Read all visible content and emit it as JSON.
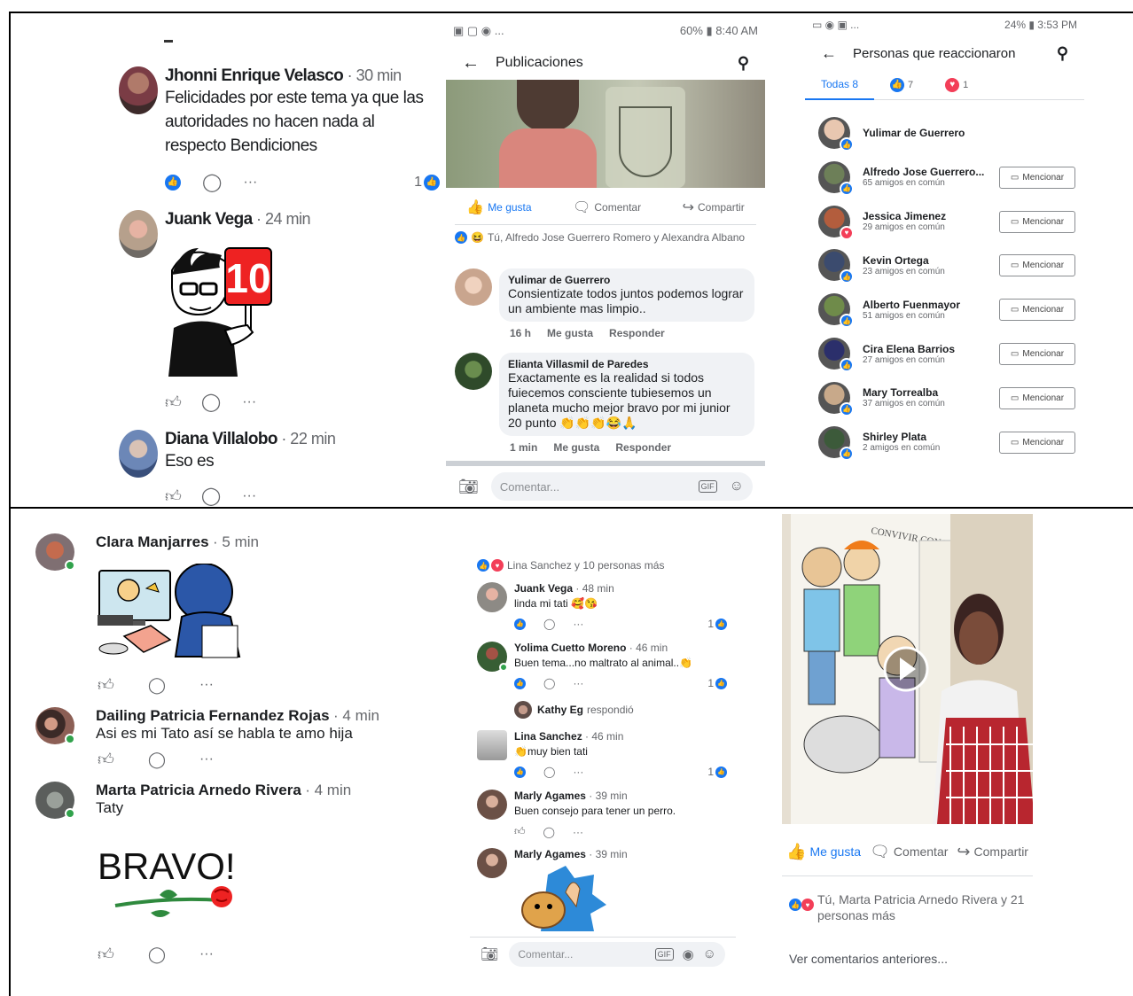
{
  "p1": {
    "comments": [
      {
        "name": "Jhonni Enrique Velasco",
        "time": "· 30 min",
        "text": "Felicidades por este tema ya que las autoridades no hacen nada al respecto Bendiciones",
        "reactions": "1"
      },
      {
        "name": "Juank Vega",
        "time": "· 24 min",
        "sticker_text": "10"
      },
      {
        "name": "Diana Villalobo",
        "time": "· 22 min",
        "text": "Eso es"
      }
    ]
  },
  "p2": {
    "status_left": "▣ ▢ ◉ ...",
    "status_right": "60% ▮ 8:40 AM",
    "title": "Publicaciones",
    "like_label": "Me gusta",
    "comment_label": "Comentar",
    "share_label": "Compartir",
    "reactors": "Tú, Alfredo Jose Guerrero Romero y Alexandra Albano",
    "comments": [
      {
        "name": "Yulimar de Guerrero",
        "text": "Consientizate todos juntos podemos lograr un ambiente mas limpio..",
        "time": "16 h",
        "like": "Me gusta",
        "reply": "Responder"
      },
      {
        "name": "Elianta Villasmil de Paredes",
        "text": "Exactamente es la realidad si todos fuiecemos consciente tubiesemos un planeta mucho mejor bravo por mi junior 20 punto 👏👏👏😂🙏",
        "time": "1 min",
        "like": "Me gusta",
        "reply": "Responder"
      }
    ],
    "comment_placeholder": "Comentar...",
    "gif": "GIF"
  },
  "p3": {
    "status_left": "▭ ◉ ▣ ...",
    "status_right": "24% ▮ 3:53 PM",
    "title": "Personas que reaccionaron",
    "tab_all": "Todas 8",
    "tab_like_count": "7",
    "tab_love_count": "1",
    "mention_label": "Mencionar",
    "people": [
      {
        "name": "Yulimar de Guerrero",
        "sub": ""
      },
      {
        "name": "Alfredo Jose Guerrero...",
        "sub": "65 amigos en común"
      },
      {
        "name": "Jessica Jimenez",
        "sub": "29 amigos en común"
      },
      {
        "name": "Kevin Ortega",
        "sub": "23 amigos en común"
      },
      {
        "name": "Alberto Fuenmayor",
        "sub": "51 amigos en común"
      },
      {
        "name": "Cira Elena Barrios",
        "sub": "27 amigos en común"
      },
      {
        "name": "Mary Torrealba",
        "sub": "37 amigos en común"
      },
      {
        "name": "Shirley Plata",
        "sub": "2 amigos en común"
      }
    ]
  },
  "p4": {
    "comments": [
      {
        "name": "Clara Manjarres",
        "time": "· 5 min"
      },
      {
        "name": "Dailing Patricia Fernandez Rojas",
        "time": "· 4 min",
        "text": "Asi es mi Tato así se habla te amo hija"
      },
      {
        "name": "Marta Patricia Arnedo Rivera",
        "time": "· 4 min",
        "text": "Taty",
        "sticker_text": "BRAVO!"
      }
    ]
  },
  "p5": {
    "reactors": "Lina Sanchez y 10 personas más",
    "comments": [
      {
        "name": "Juank Vega",
        "time": "· 48 min",
        "text": "linda mi tati 🥰😘",
        "count": "1"
      },
      {
        "name": "Yolima Cuetto Moreno",
        "time": "· 46 min",
        "text": "Buen tema...no maltrato al animal..👏",
        "count": "1"
      },
      {
        "name": "Kathy Eg",
        "replied": "respondió"
      },
      {
        "name": "Lina Sanchez",
        "time": "· 46 min",
        "text": "👏muy bien tati",
        "count": "1"
      },
      {
        "name": "Marly Agames",
        "time": "· 39 min",
        "text": "Buen consejo para tener un perro."
      },
      {
        "name": "Marly Agames",
        "time": "· 39 min"
      }
    ],
    "comment_placeholder": "Comentar...",
    "gif": "GIF"
  },
  "p6": {
    "board_title": "CONVIVIR CON LOS ANIMALES",
    "like_label": "Me gusta",
    "comment_label": "Comentar",
    "share_label": "Compartir",
    "reactors": "Tú, Marta Patricia Arnedo Rivera y 21 personas más",
    "view_previous": "Ver comentarios anteriores..."
  }
}
